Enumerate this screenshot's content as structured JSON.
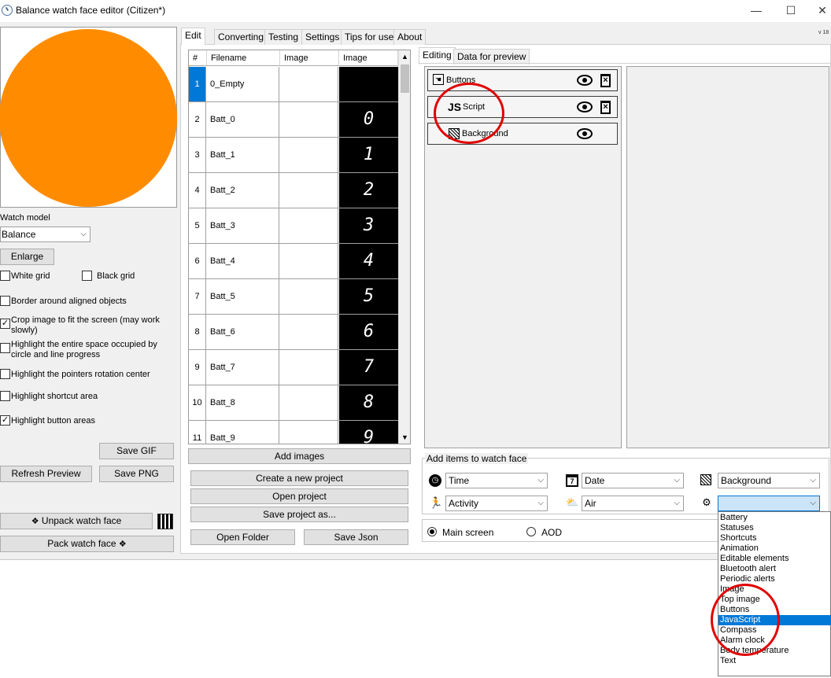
{
  "window": {
    "title": "Balance watch face editor (Citizen*)",
    "minimize": "—",
    "maximize": "☐",
    "close": "✕",
    "version": "v 18"
  },
  "preview": {
    "circle_color": "#ff8c00"
  },
  "left": {
    "watch_model_label": "Watch model",
    "watch_model_value": "Balance",
    "enlarge_label": "Enlarge",
    "white_grid": {
      "label": "White grid",
      "checked": false
    },
    "black_grid": {
      "label": "Black grid",
      "checked": false
    },
    "border_aligned": {
      "label": "Border around aligned objects",
      "checked": false
    },
    "crop_image": {
      "label": "Crop image to fit the screen (may work slowly)",
      "checked": true
    },
    "highlight_space": {
      "label": "Highlight the entire space occupied by circle and line progress",
      "checked": false
    },
    "highlight_pointers": {
      "label": "Highlight the pointers rotation center",
      "checked": false
    },
    "highlight_shortcut": {
      "label": "Highlight shortcut area",
      "checked": false
    },
    "highlight_button": {
      "label": "Highlight button areas",
      "checked": true
    },
    "save_gif": "Save GIF",
    "refresh_preview": "Refresh Preview",
    "save_png": "Save PNG",
    "unpack": "Unpack watch face",
    "pack": "Pack watch face"
  },
  "tabs": [
    "Edit",
    "Converting",
    "Testing",
    "Settings",
    "Tips for use",
    "About"
  ],
  "grid": {
    "headers": [
      "#",
      "Filename",
      "Image",
      "Image"
    ],
    "rows": [
      {
        "num": "1",
        "file": "0_Empty",
        "glyph": ""
      },
      {
        "num": "2",
        "file": "Batt_0",
        "glyph": "0"
      },
      {
        "num": "3",
        "file": "Batt_1",
        "glyph": "1"
      },
      {
        "num": "4",
        "file": "Batt_2",
        "glyph": "2"
      },
      {
        "num": "5",
        "file": "Batt_3",
        "glyph": "3"
      },
      {
        "num": "6",
        "file": "Batt_4",
        "glyph": "4"
      },
      {
        "num": "7",
        "file": "Batt_5",
        "glyph": "5"
      },
      {
        "num": "8",
        "file": "Batt_6",
        "glyph": "6"
      },
      {
        "num": "9",
        "file": "Batt_7",
        "glyph": "7"
      },
      {
        "num": "10",
        "file": "Batt_8",
        "glyph": "8"
      },
      {
        "num": "11",
        "file": "Batt_9",
        "glyph": "9"
      }
    ]
  },
  "project": {
    "add_images": "Add images",
    "create": "Create a new project",
    "open": "Open project",
    "save_as": "Save project as...",
    "open_folder": "Open Folder",
    "save_json": "Save Json"
  },
  "editor": {
    "tabs": [
      "Editing",
      "Data for preview"
    ],
    "layers": [
      {
        "name": "Buttons",
        "icon": "buttons-icon"
      },
      {
        "name": "Script",
        "icon": "js-icon",
        "badge": "JS"
      },
      {
        "name": "Background",
        "icon": "background-icon"
      }
    ]
  },
  "add_items": {
    "legend": "Add items to watch face",
    "time": "Time",
    "date": "Date",
    "background": "Background",
    "activity": "Activity",
    "air": "Air",
    "other": "",
    "main_screen": "Main screen",
    "aod": "AOD"
  },
  "dropdown": {
    "options": [
      "Battery",
      "Statuses",
      "Shortcuts",
      "Animation",
      "Editable elements",
      "Bluetooth alert",
      "Periodic alerts",
      "Image",
      "Top image",
      "Buttons",
      "JavaScript",
      "Compass",
      "Alarm clock",
      "Body temperature",
      "Text"
    ],
    "highlighted": "JavaScript"
  }
}
